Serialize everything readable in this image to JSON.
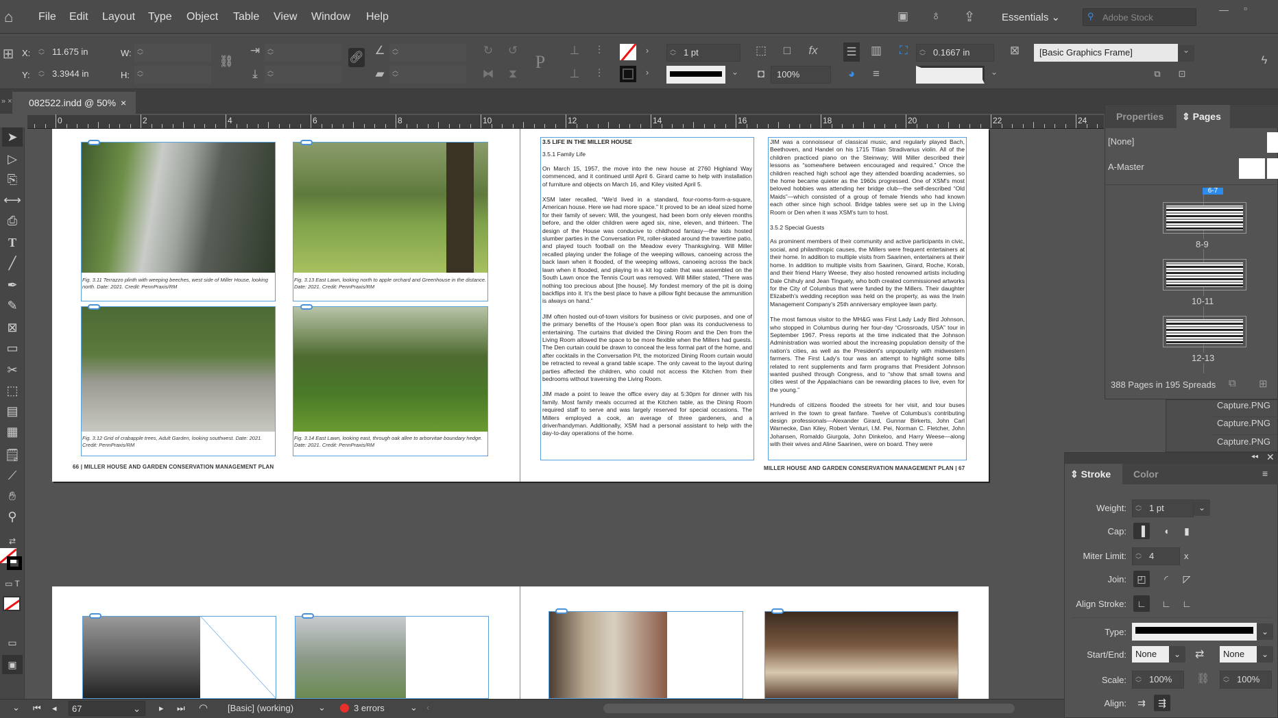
{
  "menubar": {
    "items": [
      "File",
      "Edit",
      "Layout",
      "Type",
      "Object",
      "Table",
      "View",
      "Window",
      "Help"
    ],
    "workspace": "Essentials",
    "search_placeholder": "Adobe Stock"
  },
  "control": {
    "x_label": "X:",
    "x_value": "11.675 in",
    "y_label": "Y:",
    "y_value": "3.3944 in",
    "w_label": "W:",
    "h_label": "H:",
    "stroke_weight": "1 pt",
    "opacity": "100%",
    "frame_fitting_value": "0.1667 in",
    "object_style": "[Basic Graphics Frame]"
  },
  "document_tab": {
    "title": "082522.indd @ 50%",
    "close": "×"
  },
  "ruler": {
    "labels": [
      "0",
      "2",
      "4",
      "6",
      "8",
      "10",
      "12",
      "14",
      "16",
      "18",
      "20",
      "22",
      "24"
    ]
  },
  "spread": {
    "captions": [
      "Fig. 3.11  Terrazzo plinth with weeping beeches, west side of Miller House, looking north. Date: 2021. Credit: PennPraxis/RM",
      "Fig. 3.13  East Lawn, looking north to apple orchard and Greenhouse in the distance. Date: 2021. Credit: PennPraxis/RM",
      "Fig. 3.12  Grid of crabapple trees, Adult Garden, looking southwest. Date: 2021. Credit: PennPraxis/RM",
      "Fig. 3.14  East Lawn, looking east, through oak allee to arborvitae boundary hedge. Date: 2021. Credit: PennPraxis/RM"
    ],
    "footer_left": "66  |  MILLER HOUSE AND GARDEN CONSERVATION MANAGEMENT PLAN",
    "footer_right": "MILLER HOUSE AND GARDEN CONSERVATION MANAGEMENT PLAN  |  67",
    "heading": "3.5 LIFE IN THE MILLER HOUSE",
    "subheading_1": "3.5.1 Family Life",
    "col1": [
      "On March 15, 1957, the move into the new house at 2760 Highland Way commenced, and it continued until April 6. Girard came to help with installation of furniture and objects on March 16, and Kiley visited April 5.",
      "XSM later recalled, “We'd lived in a standard, four-rooms-form-a-square, American house. Here we had more space.” It proved to be an ideal sized home for their family of seven: Will, the youngest, had been born only eleven months before, and the older children were aged six, nine, eleven, and thirteen. The design of the House was conducive to childhood fantasy—the kids hosted slumber parties in the Conversation Pit, roller-skated around the travertine patio, and played touch football on the Meadow every Thanksgiving. Will Miller recalled playing under the foliage of the weeping willows, canoeing across the back lawn when it flooded, of the weeping willows, canoeing across the back lawn when it flooded, and playing in a kit log cabin that was assembled on the South Lawn once the Tennis Court was removed. Will Miller stated, “There was nothing too precious about [the house]. My fondest memory of the pit is doing backflips into it. It's the best place to have a pillow fight because the ammunition is always on hand.”",
      "JIM often hosted out-of-town visitors for business or civic purposes, and one of the primary benefits of the House's open floor plan was its conduciveness to entertaining. The curtains that divided the Dining Room and the Den from the Living Room allowed the space to be more flexible when the Millers had guests. The Den curtain could be drawn to conceal the less formal part of the home, and after cocktails in the Conversation Pit, the motorized Dining Room curtain would be retracted to reveal a grand table scape. The only caveat to the layout during parties affected the children, who could not access the Kitchen from their bedrooms without traversing the Living Room.",
      "JIM made a point to leave the office every day at 5:30pm for dinner with his family. Most family meals occurred at the Kitchen table, as the Dining Room required staff to serve and was largely reserved for special occasions. The Millers employed a cook, an average of three gardeners, and a driver/handyman. Additionally, XSM had a personal assistant to help with the day-to-day operations of the home."
    ],
    "col2_intro": "JIM was a connoisseur of classical music, and regularly played Bach, Beethoven, and Handel on his 1715 Titian Stradivarius violin. All of the children practiced piano on the Steinway; Will Miller described their lessons as “somewhere between encouraged and required.” Once the children reached high school age they attended boarding academies, so the home became quieter as the 1960s progressed. One of XSM's most beloved hobbies was attending her bridge club—the self-described “Old Maids”—which consisted of a group of female friends who had known each other since high school. Bridge tables were set up in the Living Room or Den when it was XSM's turn to host.",
    "subheading_2": "3.5.2 Special Guests",
    "col2": [
      "As prominent members of their community and active participants in civic, social, and philanthropic causes, the Millers were frequent entertainers at their home. In addition to multiple visits from Saarinen, entertainers at their home. In addition to multiple visits from Saarinen, Girard, Roche, Korab, and their friend Harry Weese, they also hosted renowned artists including Dale Chihuly and Jean Tinguely, who both created commissioned artworks for the City of Columbus that were funded by the Millers. Their daughter Elizabeth's wedding reception was held on the property, as was the Irwin Management Company's 25th anniversary employee lawn party.",
      "The most famous visitor to the MH&G was First Lady Lady Bird Johnson, who stopped in Columbus during her four-day “Crossroads, USA” tour in September 1967. Press reports at the time indicated that the Johnson Administration was worried about the increasing population density of the nation's cities, as well as the President's unpopularity with midwestern farmers. The First Lady's tour was an attempt to highlight some bills related to rent supplements and farm programs that President Johnson wanted pushed through Congress, and to “show that small towns and cities west of the Appalachians can be rewarding places to live, even for the young.”",
      "Hundreds of citizens flooded the streets for her visit, and tour buses arrived in the town to great fanfare. Twelve of Columbus's contributing design professionals—Alexander Girard, Gunnar Birkerts, John Carl Warnecke, Dan Kiley, Robert Venturi, I.M. Pei, Norman C. Fletcher, John Johansen, Romaldo Giurgola, John Dinkeloo, and Harry Weese—along with their wives and Aline Saarinen, were on board. They were"
    ]
  },
  "pages_panel": {
    "tabs": [
      "Properties",
      "Pages"
    ],
    "active_tab": "Pages",
    "masters": [
      "[None]",
      "A-Master"
    ],
    "current_spread": "6-7",
    "spreads": [
      "8-9",
      "10-11",
      "12-13"
    ],
    "summary": "388 Pages in 195 Spreads"
  },
  "links_panel": {
    "items": [
      "Capture.PNG",
      "Capture.PNG",
      "Capture.PNG"
    ]
  },
  "stroke_panel": {
    "tabs": [
      "Stroke",
      "Color"
    ],
    "weight_label": "Weight:",
    "weight": "1 pt",
    "cap_label": "Cap:",
    "miter_label": "Miter Limit:",
    "miter": "4",
    "miter_unit": "x",
    "join_label": "Join:",
    "align_stroke_label": "Align Stroke:",
    "type_label": "Type:",
    "start_end_label": "Start/End:",
    "start": "None",
    "end": "None",
    "scale_label": "Scale:",
    "scale_start": "100%",
    "scale_end": "100%",
    "align_label": "Align:"
  },
  "status": {
    "page": "67",
    "preflight_profile": "[Basic] (working)",
    "errors": "3 errors",
    "error_color": "#e8302a"
  },
  "colors": {
    "accent": "#2d8ceb",
    "frame_outline": "#5aa0e0"
  }
}
